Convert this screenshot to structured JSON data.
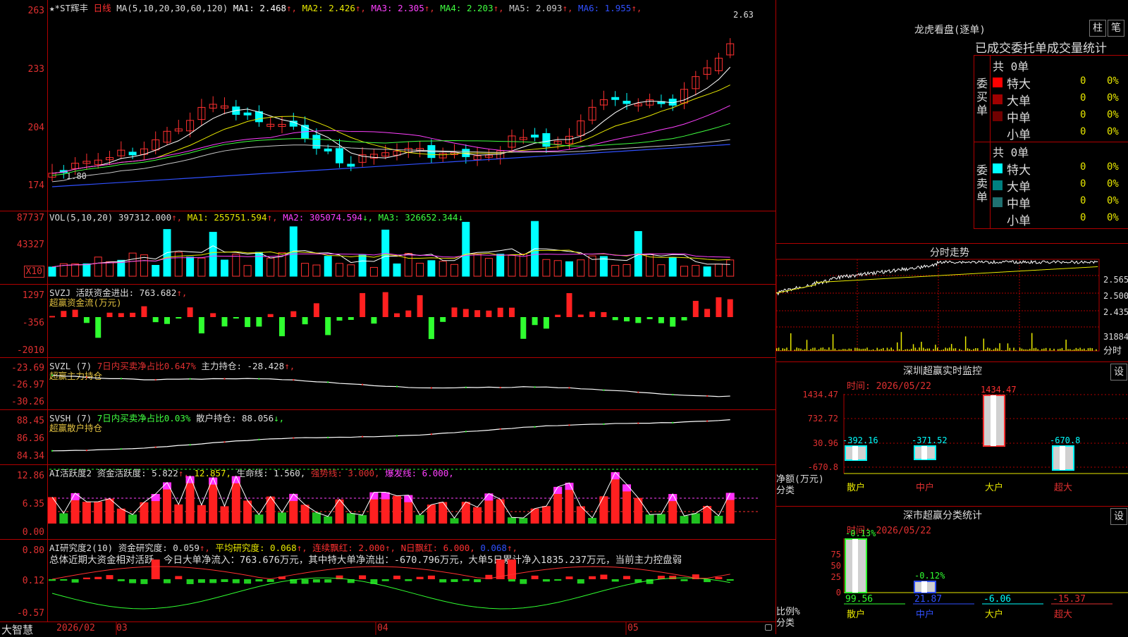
{
  "main": {
    "stock_name": "★*ST辉丰",
    "period": "日线",
    "ma_label": "MA(5,10,20,30,60,120)",
    "ma_values": [
      {
        "label": "MA1:",
        "value": "2.468",
        "arrow": "↑",
        "color": "#ffffff"
      },
      {
        "label": "MA2:",
        "value": "2.426",
        "arrow": "↑",
        "color": "#e8e800"
      },
      {
        "label": "MA3:",
        "value": "2.305",
        "arrow": "↑",
        "color": "#ff40ff"
      },
      {
        "label": "MA4:",
        "value": "2.203",
        "arrow": "↑",
        "color": "#40ff40"
      },
      {
        "label": "MA5:",
        "value": "2.093",
        "arrow": "↑",
        "color": "#c8c8c8"
      },
      {
        "label": "MA6:",
        "value": "1.955",
        "arrow": "↑",
        "color": "#3050ff"
      }
    ],
    "y_ticks": [
      "263",
      "233",
      "204",
      "174"
    ],
    "max_label": "2.63",
    "min_label": "1.80"
  },
  "vol": {
    "title": "VOL(5,10,20)",
    "value": "397312.000",
    "ma1": "MA1: 255751.594",
    "ma2": "MA2: 305074.594",
    "ma3": "MA3: 326652.344",
    "y_ticks": [
      "87737",
      "43327"
    ],
    "unit": "X10"
  },
  "svzj": {
    "title": "SVZJ  活跃资金进出: 763.682",
    "subtitle": "超赢资金流(万元)",
    "y_ticks": [
      "1297",
      "-356",
      "-2010"
    ]
  },
  "svzl": {
    "title": "SVZL (7)",
    "ratio": "7日内买卖净占比0.647%",
    "hold": "主力持仓: -28.428",
    "subtitle": "超赢主力持仓",
    "y_ticks": [
      "-23.69",
      "-26.97",
      "-30.26"
    ]
  },
  "svsh": {
    "title": "SVSH (7)",
    "ratio": "7日内买卖净占比0.03%",
    "hold": "散户持仓: 88.056",
    "subtitle": "超赢散户持仓",
    "y_ticks": [
      "88.45",
      "86.36",
      "84.34"
    ]
  },
  "ai1": {
    "title": "AI活跃度2",
    "v1": "资金活跃度: 5.822",
    "v2": "12.857,",
    "v3": "生命线: 1.560,",
    "v4": "强势线: 3.000,",
    "v5": "爆发线: 6.000,",
    "y_ticks": [
      "12.86",
      "6.35",
      "0.00"
    ]
  },
  "ai2": {
    "title": "AI研究度2(10)",
    "v1": "资金研究度: 0.059",
    "v2": "平均研究度: 0.068",
    "v3": "连续飘红: 2.000",
    "v4": "N日飘红: 6.000,",
    "v5": "0.068",
    "summary": "总体近期大资金相对活跃，今日大单净流入：763.676万元，其中特大单净流出：-670.796万元，大单5日累计净入1835.237万元，当前主力控盘弱",
    "y_ticks": [
      "0.80",
      "0.12",
      "-0.57"
    ]
  },
  "bottom_axis": {
    "brand": "大智慧",
    "labels": [
      "2026/02",
      "03",
      "04",
      "05"
    ]
  },
  "lhb": {
    "title": "龙虎看盘(逐单)",
    "btn1": "柱",
    "btn2": "笔",
    "tabs": "已成交委托单成交量统计",
    "buy_label": "委买单",
    "sell_label": "委卖单",
    "buy_total": "共 0单",
    "sell_total": "共 0单",
    "buy_rows": [
      {
        "label": "特大",
        "count": "0",
        "pct": "0%",
        "color": "#ff0000"
      },
      {
        "label": "大单",
        "count": "0",
        "pct": "0%",
        "color": "#a00000"
      },
      {
        "label": "中单",
        "count": "0",
        "pct": "0%",
        "color": "#700000"
      },
      {
        "label": "小单",
        "count": "0",
        "pct": "0%",
        "color": "#000000"
      }
    ],
    "sell_rows": [
      {
        "label": "特大",
        "count": "0",
        "pct": "0%",
        "color": "#00ffff"
      },
      {
        "label": "大单",
        "count": "0",
        "pct": "0%",
        "color": "#008080"
      },
      {
        "label": "中单",
        "count": "0",
        "pct": "0%",
        "color": "#207070"
      },
      {
        "label": "小单",
        "count": "0",
        "pct": "0%",
        "color": "#000000"
      }
    ]
  },
  "fenshi": {
    "title": "分时走势",
    "y_ticks": [
      "2.565",
      "2.500",
      "2.435"
    ],
    "vol_label": "31884",
    "bottom_label": "分时"
  },
  "sz_monitor": {
    "title": "深圳超赢实时监控",
    "btn": "设",
    "time": "时间: 2026/05/22",
    "y_ticks": [
      "1434.47",
      "732.72",
      "30.96",
      "-670.8"
    ],
    "side_label1": "净额(万元)",
    "side_label2": "分类",
    "categories": [
      "散户",
      "中户",
      "大户",
      "超大"
    ],
    "values": [
      "-392.16",
      "-371.52",
      "1434.47",
      "-670.8"
    ]
  },
  "sz_class": {
    "title": "深市超赢分类统计",
    "btn": "设",
    "time": "时间: 2026/05/22",
    "y_ticks": [
      "75",
      "50",
      "25",
      "0"
    ],
    "side_label1": "比例%",
    "side_label2": "分类",
    "categories": [
      "散户",
      "中户",
      "大户",
      "超大"
    ],
    "top_values": [
      "-0.13%",
      "-0.12%"
    ],
    "bottom_values": [
      "99.56",
      "21.87",
      "-6.06",
      "-15.37"
    ]
  }
}
